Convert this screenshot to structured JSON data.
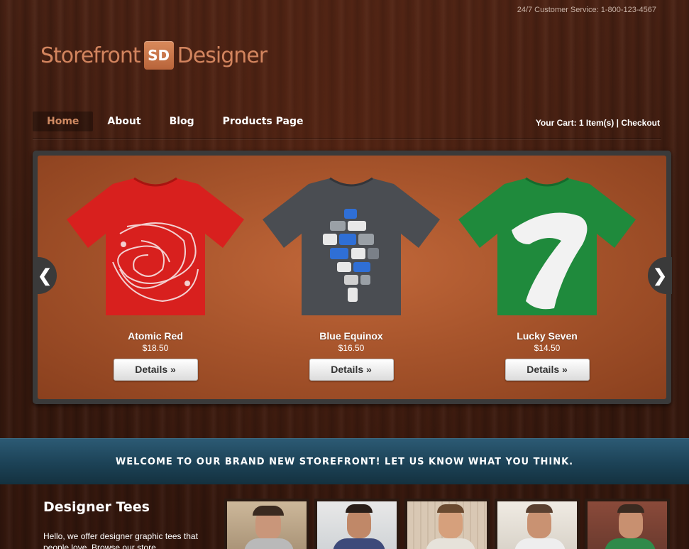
{
  "header": {
    "customer_service": "24/7 Customer Service: 1-800-123-4567",
    "logo": {
      "left": "Storefront",
      "badge": "SD",
      "right": "Designer"
    }
  },
  "nav": {
    "items": [
      {
        "label": "Home",
        "active": true
      },
      {
        "label": "About",
        "active": false
      },
      {
        "label": "Blog",
        "active": false
      },
      {
        "label": "Products Page",
        "active": false
      }
    ],
    "cart": {
      "label": "Your Cart: 1 Item(s)",
      "separator": " | ",
      "checkout": "Checkout"
    }
  },
  "slider": {
    "prev_icon": "❮",
    "next_icon": "❯",
    "products": [
      {
        "name": "Atomic Red",
        "price": "$18.50",
        "button": "Details »",
        "color": "#d8201e"
      },
      {
        "name": "Blue Equinox",
        "price": "$16.50",
        "button": "Details »",
        "color": "#4a4d52"
      },
      {
        "name": "Lucky Seven",
        "price": "$14.50",
        "button": "Details »",
        "color": "#1f8a3c"
      }
    ]
  },
  "welcome_banner": "WELCOME TO OUR BRAND NEW STOREFRONT! LET US KNOW WHAT YOU THINK.",
  "about": {
    "title": "Designer Tees",
    "text": "Hello, we offer designer graphic tees that people love. Browse our store"
  },
  "photos": [
    {
      "name": "photo-1"
    },
    {
      "name": "photo-2"
    },
    {
      "name": "photo-3"
    },
    {
      "name": "photo-4"
    },
    {
      "name": "photo-5"
    }
  ],
  "colors": {
    "accent": "#d2845e",
    "banner": "#1c4256",
    "slider_bg": "#a8552c"
  }
}
